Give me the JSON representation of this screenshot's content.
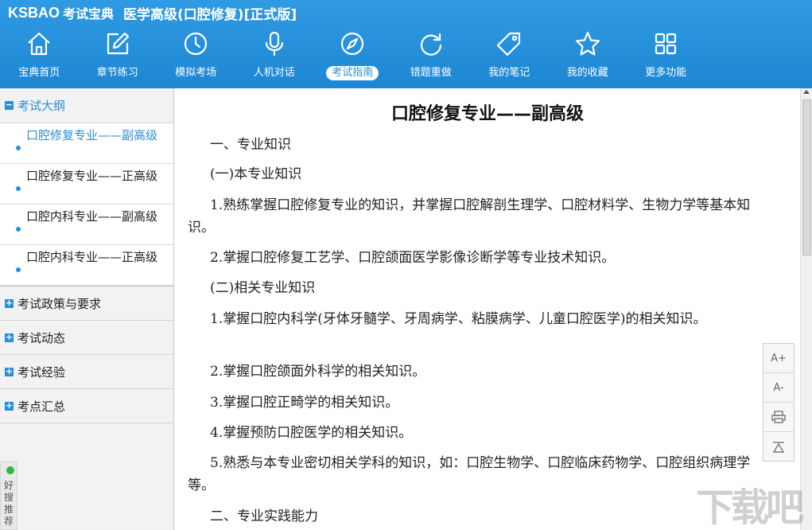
{
  "header": {
    "logo": "KSBAO",
    "logo_sub": "考试宝典",
    "title": "医学高级(口腔修复)[正式版]",
    "nav": [
      {
        "label": "宝典首页",
        "icon": "home-icon"
      },
      {
        "label": "章节练习",
        "icon": "edit-icon"
      },
      {
        "label": "模拟考场",
        "icon": "clock-icon"
      },
      {
        "label": "人机对话",
        "icon": "microphone-icon"
      },
      {
        "label": "考试指南",
        "icon": "compass-icon",
        "active": true
      },
      {
        "label": "错题重做",
        "icon": "refresh-icon"
      },
      {
        "label": "我的笔记",
        "icon": "tag-icon"
      },
      {
        "label": "我的收藏",
        "icon": "star-icon"
      },
      {
        "label": "更多功能",
        "icon": "grid-icon"
      }
    ]
  },
  "sidebar": {
    "open_section": "考试大纲",
    "sub_items": [
      "口腔修复专业——副高级",
      "口腔修复专业——正高级",
      "口腔内科专业——副高级",
      "口腔内科专业——正高级"
    ],
    "sections": [
      "考试政策与要求",
      "考试动态",
      "考试经验",
      "考点汇总"
    ],
    "badge": "好搜推荐"
  },
  "content": {
    "title": "口腔修复专业——副高级",
    "paragraphs": [
      "一、专业知识",
      "(一)本专业知识",
      "1.熟练掌握口腔修复专业的知识，并掌握口腔解剖生理学、口腔材料学、生物力学等基本知识。",
      "2.掌握口腔修复工艺学、口腔颌面医学影像诊断学等专业技术知识。",
      "(二)相关专业知识",
      "1.掌握口腔内科学(牙体牙髓学、牙周病学、粘膜病学、儿童口腔医学)的相关知识。",
      "2.掌握口腔颌面外科学的相关知识。",
      "3.掌握口腔正畸学的相关知识。",
      "4.掌握预防口腔医学的相关知识。",
      "5.熟悉与本专业密切相关学科的知识，如：口腔生物学、口腔临床药物学、口腔组织病理学等。",
      "二、专业实践能力"
    ]
  },
  "tools": [
    "A+",
    "A-"
  ],
  "watermark": "下载吧",
  "colors": {
    "header": "#2a8fd9",
    "accent": "#2a8fd9"
  }
}
